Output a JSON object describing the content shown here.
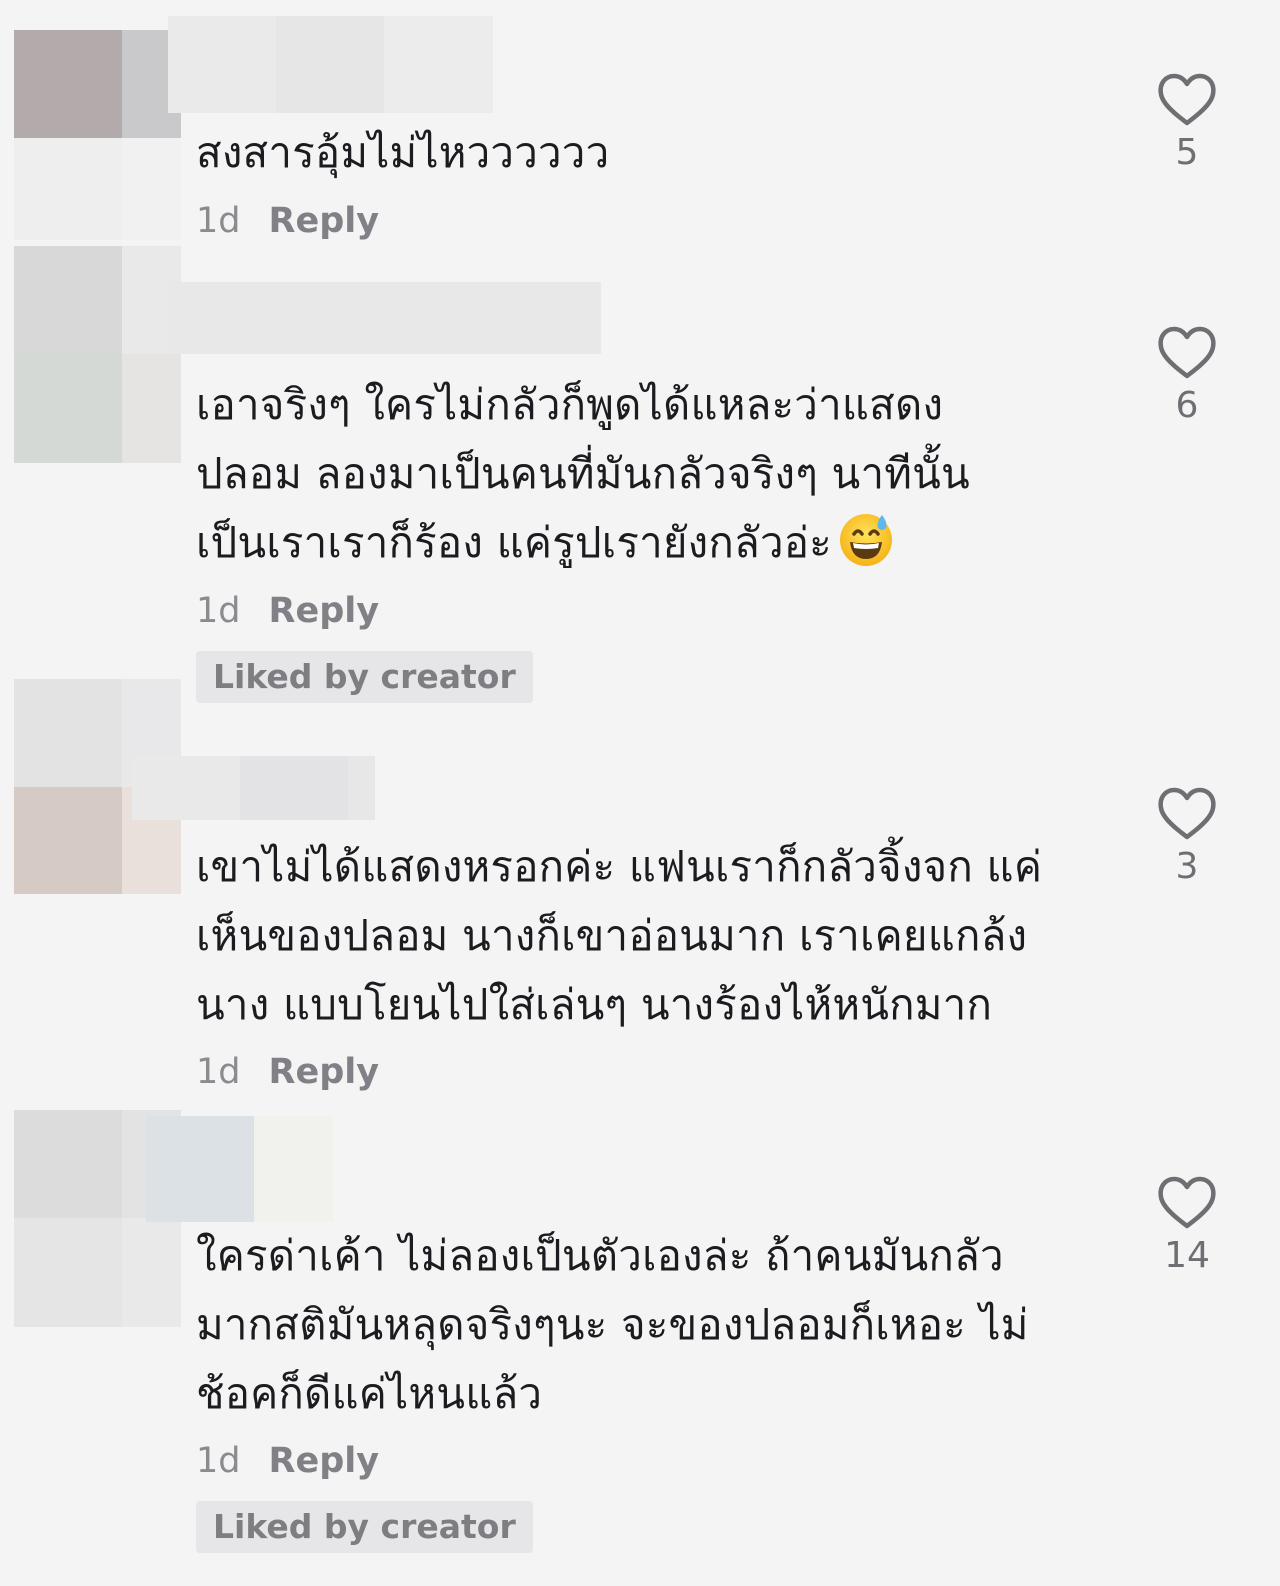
{
  "comments": [
    {
      "text_lines": [
        "สงสารอุ้มไม่ไหวววววว"
      ],
      "age": "1d",
      "reply_label": "Reply",
      "likes": "5",
      "liked_by_creator": null
    },
    {
      "text_lines": [
        "เอาจริงๆ ใครไม่กลัวก็พูดได้แหละว่าแสดง",
        "ปลอม ลองมาเป็นคนที่มันกลัวจริงๆ นาทีนั้น",
        "เป็นเราเราก็ร้อง แค่รูปเรายังกลัวอ่ะ"
      ],
      "age": "1d",
      "reply_label": "Reply",
      "likes": "6",
      "liked_by_creator": "Liked by creator"
    },
    {
      "text_lines": [
        "เขาไม่ได้แสดงหรอกค่ะ แฟนเราก็กลัวจิ้งจก แค่",
        "เห็นของปลอม นางก็เขาอ่อนมาก เราเคยแกล้ง",
        "นาง แบบโยนไปใส่เล่นๆ นางร้องไห้หนักมาก"
      ],
      "age": "1d",
      "reply_label": "Reply",
      "likes": "3",
      "liked_by_creator": null
    },
    {
      "text_lines": [
        "ใครด่าเค้า ไม่ลองเป็นตัวเองล่ะ ถ้าคนมันกลัว",
        "มากสติมันหลุดจริงๆนะ จะของปลอมก็เหอะ ไม่",
        "ช้อคก็ดีแค่ไหนแล้ว"
      ],
      "age": "1d",
      "reply_label": "Reply",
      "likes": "14",
      "liked_by_creator": "Liked by creator"
    }
  ],
  "icons": {
    "like": "heart-outline-icon",
    "emoji": "grinning-face-with-sweat-emoji"
  },
  "colors": {
    "background": "#f4f4f4",
    "text": "#1c1c20",
    "meta": "#8a8a8f",
    "badge_bg": "#e6e6e8",
    "icon": "#6e6e73"
  }
}
